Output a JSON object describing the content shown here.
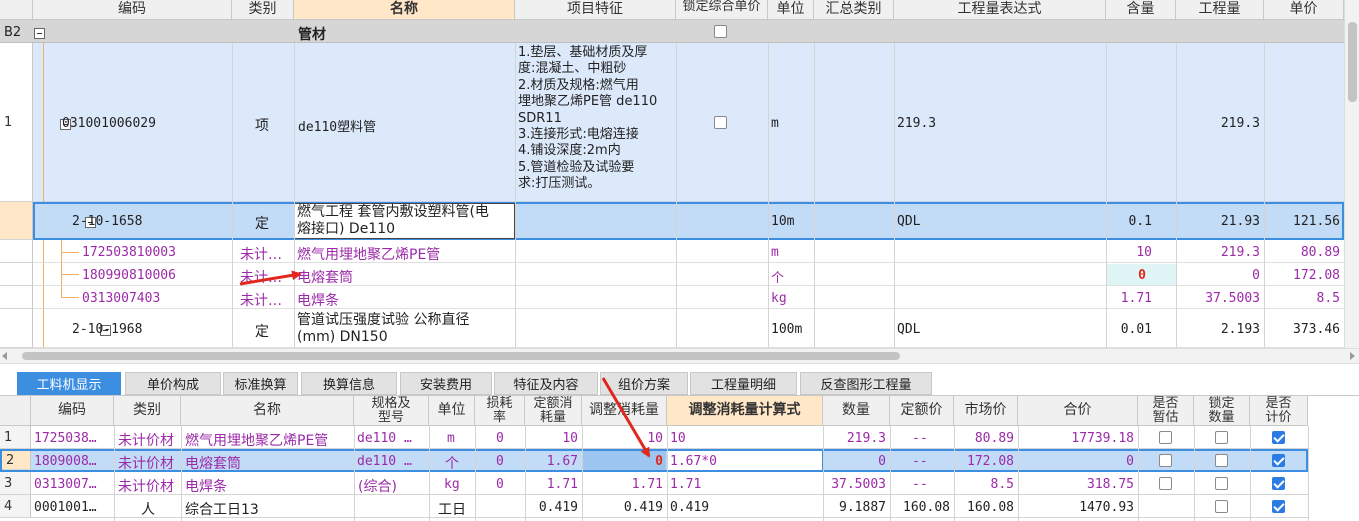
{
  "top_headers": [
    "编码",
    "类别",
    "名称",
    "项目特征",
    "锁定综合单价",
    "单位",
    "汇总类别",
    "工程量表达式",
    "含量",
    "工程量",
    "单价"
  ],
  "section": {
    "id": "B2",
    "name": "管材"
  },
  "rows": [
    {
      "num": "1",
      "code": "031001006029",
      "type": "项",
      "name": "de110塑料管",
      "features": [
        "1.垫层、基础材质及厚",
        "度:混凝土、中粗砂",
        "2.材质及规格:燃气用",
        "埋地聚乙烯PE管 de110",
        "SDR11",
        "3.连接形式:电熔连接",
        "4.铺设深度:2m内",
        "5.管道检验及试验要",
        "求:打压测试。"
      ],
      "unit": "m",
      "expr": "219.3",
      "qty": "219.3"
    },
    {
      "code": "2-10-1658",
      "type": "定",
      "name_lines": [
        "燃气工程 套管内敷设塑料管(电",
        "熔接口) De110"
      ],
      "unit": "10m",
      "expr": "QDL",
      "content": "0.1",
      "qty": "21.93",
      "price": "121.56"
    },
    {
      "code": "172503810003",
      "type": "未计…",
      "name": "燃气用埋地聚乙烯PE管",
      "unit": "m",
      "content": "10",
      "qty": "219.3",
      "price": "80.89"
    },
    {
      "code": "180990810006",
      "type": "未计…",
      "name": "电熔套筒",
      "unit": "个",
      "content": "0",
      "qty": "0",
      "price": "172.08"
    },
    {
      "code": "0313007403",
      "type": "未计…",
      "name": "电焊条",
      "unit": "kg",
      "content": "1.71",
      "qty": "37.5003",
      "price": "8.5"
    },
    {
      "code": "2-10-1968",
      "type": "定",
      "name_lines": [
        "管道试压强度试验 公称直径",
        "(mm) DN150"
      ],
      "unit": "100m",
      "expr": "QDL",
      "content": "0.01",
      "qty": "2.193",
      "price": "373.46"
    }
  ],
  "tabs": [
    "工料机显示",
    "单价构成",
    "标准换算",
    "换算信息",
    "安装费用",
    "特征及内容",
    "组价方案",
    "工程量明细",
    "反查图形工程量"
  ],
  "bottom_headers": [
    "编码",
    "类别",
    "名称",
    "规格及型号",
    "单位",
    "损耗率",
    "定额消耗量",
    "调整消耗量",
    "调整消耗量计算式",
    "数量",
    "定额价",
    "市场价",
    "合价",
    "是否暂估",
    "锁定数量",
    "是否计价"
  ],
  "bottom_rows": [
    {
      "num": "1",
      "code": "1725038…",
      "type": "未计价材",
      "name": "燃气用埋地聚乙烯PE管",
      "spec": "de110 …",
      "unit": "m",
      "loss": "0",
      "std": "10",
      "adj": "10",
      "formula": "10",
      "qty": "219.3",
      "std_price": "--",
      "mkt": "80.89",
      "total": "17739.18",
      "est": false,
      "lock": false,
      "priced": true
    },
    {
      "num": "2",
      "code": "1809008…",
      "type": "未计价材",
      "name": "电熔套筒",
      "spec": "de110 …",
      "unit": "个",
      "loss": "0",
      "std": "1.67",
      "adj": "0",
      "formula": "1.67*0",
      "qty": "0",
      "std_price": "--",
      "mkt": "172.08",
      "total": "0",
      "est": false,
      "lock": false,
      "priced": true
    },
    {
      "num": "3",
      "code": "0313007…",
      "type": "未计价材",
      "name": "电焊条",
      "spec": "(综合)",
      "unit": "kg",
      "loss": "0",
      "std": "1.71",
      "adj": "1.71",
      "formula": "1.71",
      "qty": "37.5003",
      "std_price": "--",
      "mkt": "8.5",
      "total": "318.75",
      "est": false,
      "lock": false,
      "priced": true
    },
    {
      "num": "4",
      "code": "0001001…",
      "type": "人",
      "name": "综合工日13",
      "spec": "",
      "unit": "工日",
      "loss": "",
      "std": "0.419",
      "adj": "0.419",
      "formula": "0.419",
      "qty": "9.1887",
      "std_price": "160.08",
      "mkt": "160.08",
      "total": "1470.93",
      "est": false,
      "lock": false,
      "priced": true
    }
  ],
  "colors": {
    "accent": "#3c8ee0",
    "purple": "#9c2aa8",
    "red": "#e0281e",
    "row_blue": "#dce9fb"
  }
}
